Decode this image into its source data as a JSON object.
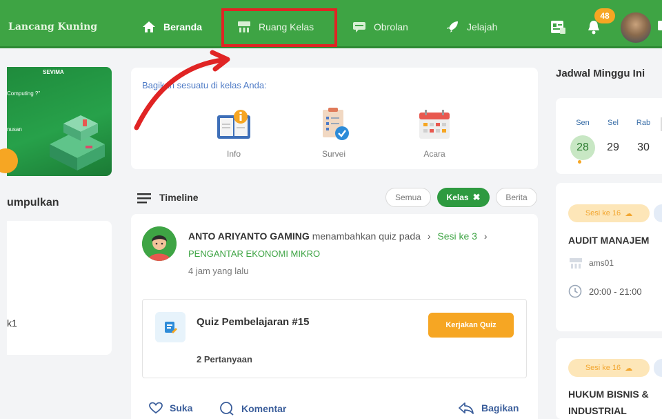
{
  "nav": {
    "brand": "Lancang Kuning",
    "items": [
      {
        "label": "Beranda",
        "icon": "home-icon"
      },
      {
        "label": "Ruang Kelas",
        "icon": "classroom-icon"
      },
      {
        "label": "Obrolan",
        "icon": "chat-icon"
      },
      {
        "label": "Jelajah",
        "icon": "rocket-icon"
      }
    ],
    "notification_count": "48"
  },
  "left": {
    "banner_brand": "SEVIMA",
    "banner_line1": "Computing ?\"",
    "banner_line2": "nusan",
    "heading": "umpulkan",
    "item": "k1"
  },
  "share": {
    "title": "Bagikan sesuatu di kelas Anda:",
    "items": [
      {
        "label": "Info",
        "icon": "info-icon"
      },
      {
        "label": "Survei",
        "icon": "survey-icon"
      },
      {
        "label": "Acara",
        "icon": "calendar-icon"
      }
    ]
  },
  "timeline": {
    "title": "Timeline",
    "filters": {
      "all": "Semua",
      "class": "Kelas",
      "news": "Berita"
    },
    "post": {
      "author": "ANTO ARIYANTO GAMING",
      "verb": "menambahkan quiz pada",
      "session": "Sesi ke 3",
      "course": "PENGANTAR EKONOMI MIKRO",
      "time": "4 jam yang lalu",
      "quiz_title": "Quiz Pembelajaran #15",
      "quiz_button": "Kerjakan Quiz",
      "quiz_count": "2 Pertanyaan",
      "actions": {
        "like": "Suka",
        "comment": "Komentar",
        "share": "Bagikan"
      }
    }
  },
  "schedule": {
    "title": "Jadwal Minggu Ini",
    "days": [
      {
        "day": "Sen",
        "date": "28",
        "active": true
      },
      {
        "day": "Sel",
        "date": "29",
        "active": false
      },
      {
        "day": "Rab",
        "date": "30",
        "active": false
      }
    ],
    "items": [
      {
        "session": "Sesi ke 16",
        "title": "AUDIT MANAJEM",
        "room": "ams01",
        "time": "20:00 - 21:00"
      },
      {
        "session": "Sesi ke 16",
        "title": "HUKUM BISNIS &",
        "title2": "INDUSTRIAL"
      }
    ]
  },
  "colors": {
    "primary": "#3ea444",
    "accent": "#f6a623",
    "annotation": "#e02424"
  }
}
